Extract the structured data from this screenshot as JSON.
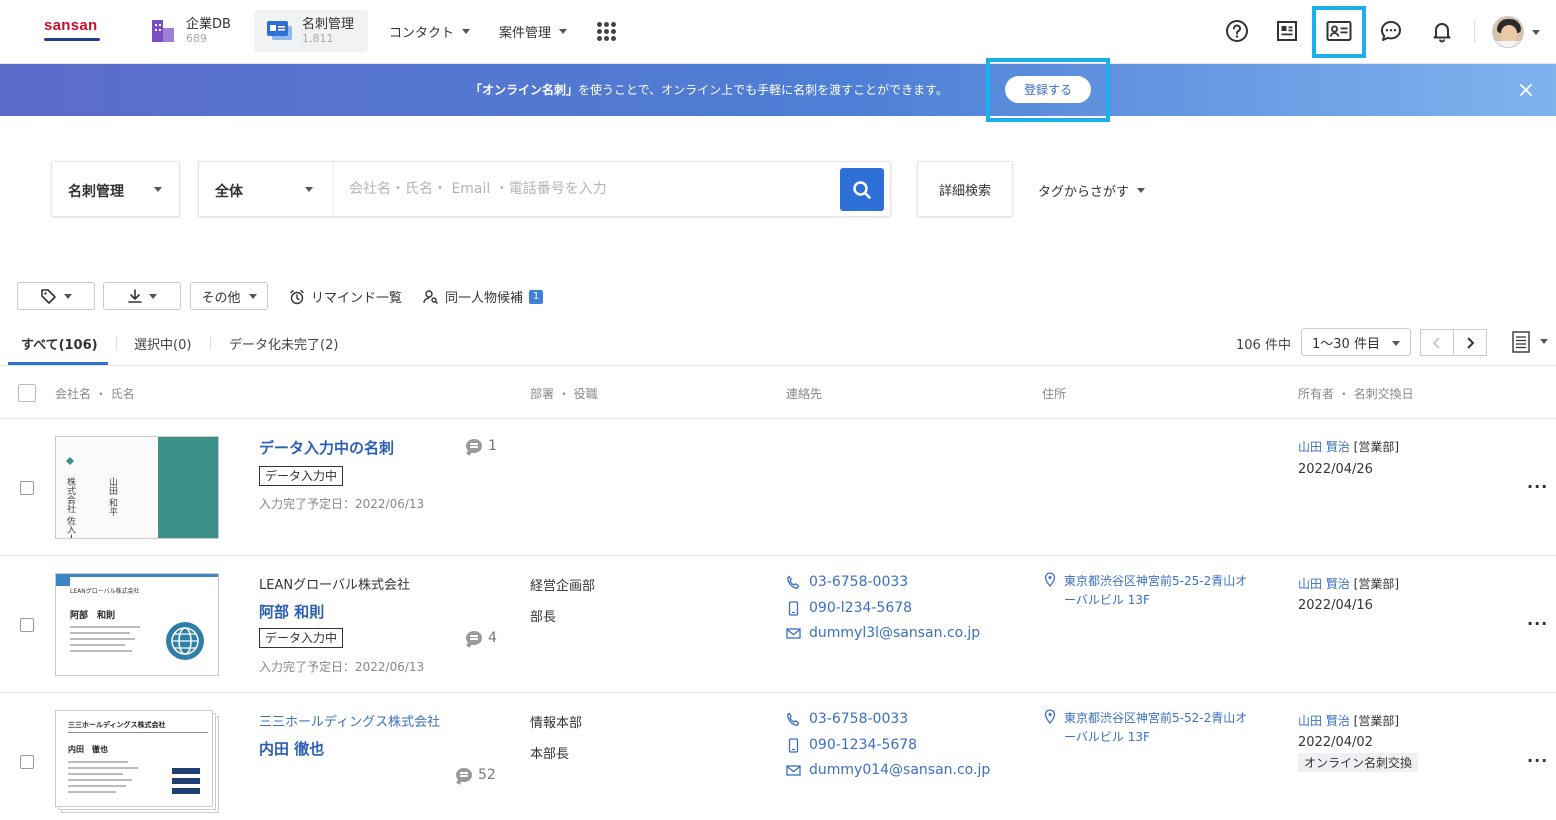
{
  "header": {
    "logo": "sansan",
    "apps": [
      {
        "label": "企業DB",
        "count": "689"
      },
      {
        "label": "名刺管理",
        "count": "1,811"
      }
    ],
    "menus": [
      "コンタクト",
      "案件管理"
    ]
  },
  "banner": {
    "bold": "「オンライン名刺」",
    "text": "を使うことで、オンライン上でも手軽に名刺を渡すことができます。",
    "button": "登録する"
  },
  "search": {
    "scope": "名刺管理",
    "filter": "全体",
    "placeholder": "会社名・氏名・ Email ・電話番号を入力",
    "advanced": "詳細検索",
    "tag_search": "タグからさがす"
  },
  "toolbar": {
    "other": "その他",
    "remind": "リマインド一覧",
    "duplicate": "同一人物候補",
    "duplicate_count": "1"
  },
  "tabs": [
    "すべて(106)",
    "選択中(0)",
    "データ化未完了(2)"
  ],
  "pagination": {
    "count": "106 件中",
    "range": "1〜30 件目"
  },
  "columns": [
    "会社名 ・ 氏名",
    "部署 ・ 役職",
    "連絡先",
    "住所",
    "所有者 ・ 名刺交換日"
  ],
  "rows": [
    {
      "name": "データ入力中の名刺",
      "status": "データ入力中",
      "due": "入力完了予定日：2022/06/13",
      "comments": "1",
      "owner": "山田 賢治",
      "owner_dept": "[営業部]",
      "date": "2022/04/26",
      "card_text": [
        "株式会社 佐入人",
        "山田 和平"
      ]
    },
    {
      "company": "LEANグローバル株式会社",
      "name": "阿部 和則",
      "status": "データ入力中",
      "due": "入力完了予定日：2022/06/13",
      "comments": "4",
      "dept": "経営企画部",
      "title": "部長",
      "phone": "03-6758-0033",
      "mobile": "090-l234-5678",
      "email": "dummyl3l@sansan.co.jp",
      "address": "東京都渋谷区神宮前5-25-2青山オーバルビル 13F",
      "owner": "山田 賢治",
      "owner_dept": "[営業部]",
      "date": "2022/04/16",
      "card_text": [
        "LEANグローバル株式会社",
        "阿部　和則"
      ]
    },
    {
      "company": "三三ホールディングス株式会社",
      "name": "内田 徹也",
      "comments": "52",
      "dept": "情報本部",
      "title": "本部長",
      "phone": "03-6758-0033",
      "mobile": "090-1234-5678",
      "email": "dummy014@sansan.co.jp",
      "address": "東京都渋谷区神宮前5-52-2青山オーバルビル 13F",
      "owner": "山田 賢治",
      "owner_dept": "[営業部]",
      "date": "2022/04/02",
      "exchange_tag": "オンライン名刺交換",
      "card_text": [
        "三三ホールディングス株式会社",
        "内田　徹也"
      ]
    }
  ]
}
